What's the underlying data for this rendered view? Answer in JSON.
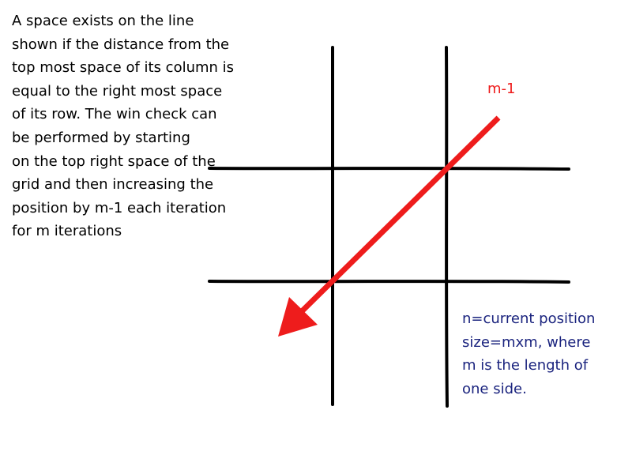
{
  "description": {
    "lines": [
      "A space exists on the line",
      "shown if the distance from the",
      "top most space of its column is",
      "equal to the  right most space",
      "of its row. The win check can",
      "be performed by starting",
      "on the top right space of the",
      "grid and then increasing the",
      "position by m-1 each iteration",
      "for m iterations"
    ]
  },
  "arrow": {
    "label": "m-1",
    "color": "#ee1c1c"
  },
  "grid": {
    "line_color": "#000000",
    "rows": 3,
    "cols": 3
  },
  "notes": {
    "color": "#1a237e",
    "lines": [
      "n=current position",
      "size=mxm, where",
      "m is the length of",
      "one side."
    ]
  }
}
